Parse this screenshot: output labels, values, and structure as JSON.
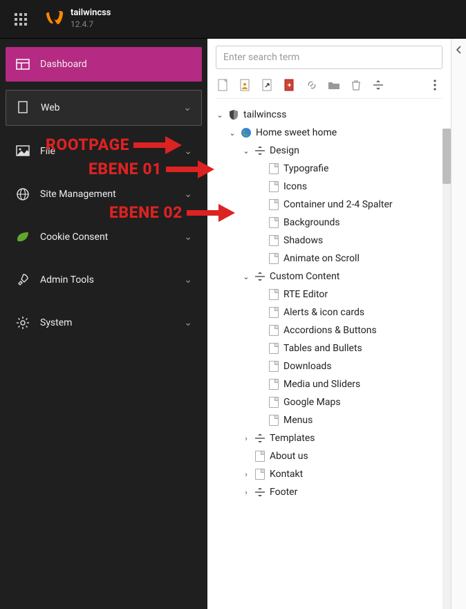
{
  "topbar": {
    "app_name": "tailwincss",
    "version": "12.4.7"
  },
  "sidebar": {
    "items": [
      {
        "label": "Dashboard"
      },
      {
        "label": "Web"
      },
      {
        "label": "File"
      },
      {
        "label": "Site Management"
      },
      {
        "label": "Cookie Consent"
      },
      {
        "label": "Admin Tools"
      },
      {
        "label": "System"
      }
    ]
  },
  "search": {
    "placeholder": "Enter search term"
  },
  "tree": {
    "root": "tailwincss",
    "home": "Home sweet home",
    "design": "Design",
    "design_children": [
      "Typografie",
      "Icons",
      "Container und 2-4 Spalter",
      "Backgrounds",
      "Shadows",
      "Animate on Scroll"
    ],
    "custom": "Custom Content",
    "custom_children": [
      "RTE Editor",
      "Alerts & icon cards",
      "Accordions & Buttons",
      "Tables and Bullets",
      "Downloads",
      "Media und Sliders",
      "Google Maps",
      "Menus"
    ],
    "templates": "Templates",
    "about": "About us",
    "kontakt": "Kontakt",
    "footer": "Footer"
  },
  "annotations": {
    "rootpage": "ROOTPAGE",
    "ebene01": "EBENE 01",
    "ebene02": "EBENE 02"
  }
}
